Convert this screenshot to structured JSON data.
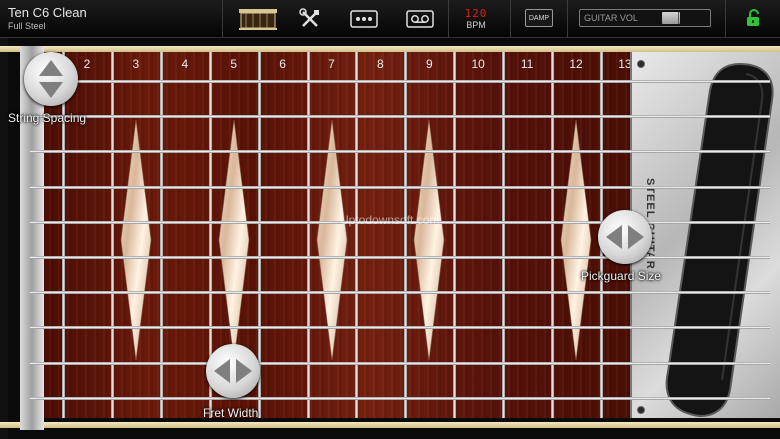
{
  "toolbar": {
    "preset_name": "Ten C6 Clean",
    "preset_sub": "Full Steel",
    "icons": [
      "instrument-icon",
      "tools-icon",
      "controller-icon",
      "tape-icon"
    ],
    "bpm_value": "120",
    "bpm_label": "BPM",
    "damp_label": "DAMP",
    "volume_label": "GUITAR VOL",
    "volume_level": 0.38,
    "lock_state": "unlocked",
    "accent": "#e21b1b",
    "lock_color": "#2fc23a"
  },
  "fretboard": {
    "fret_numbers": [
      "2",
      "3",
      "4",
      "5",
      "6",
      "7",
      "8",
      "9",
      "10",
      "11",
      "12",
      "13"
    ],
    "string_count": 10,
    "inlay_frets": [
      "3",
      "5",
      "7",
      "9",
      "12"
    ],
    "wood_color": "#6b1a0a"
  },
  "controls": {
    "string_spacing_label": "String Spacing",
    "fret_width_label": "Fret Width",
    "pickguard_size_label": "Pickguard Size"
  },
  "watermark": "Uptodownsoft.com",
  "pickup_brand": "STEEL GUITAR"
}
